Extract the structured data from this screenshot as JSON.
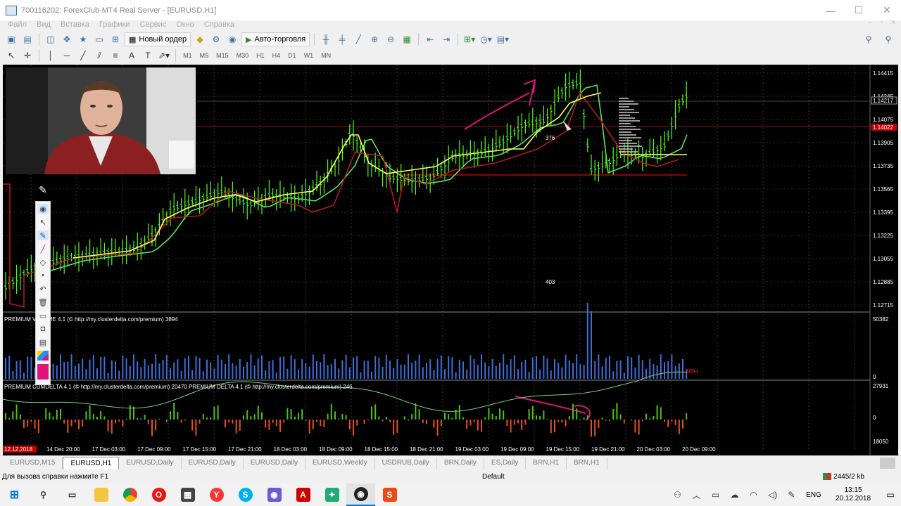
{
  "window": {
    "title": "700116202: ForexClub-MT4 Real Server - [EURUSD,H1]",
    "controls": [
      "—",
      "☐",
      "✕"
    ]
  },
  "menu": [
    "Файл",
    "Вид",
    "Вставка",
    "Графики",
    "Сервис",
    "Окно",
    "Справка"
  ],
  "toolbar": {
    "new_order": "Новый ордер",
    "auto_trading": "Авто-торговля"
  },
  "timeframes": [
    "M1",
    "M5",
    "M15",
    "M30",
    "H1",
    "H4",
    "D1",
    "W1",
    "MN"
  ],
  "chart": {
    "symbol": "EURUSD,H1",
    "price_scale": [
      "1.14415",
      "1.14245",
      "1.14075",
      "1.13905",
      "1.13735",
      "1.13565",
      "1.13395",
      "1.13225",
      "1.13055",
      "1.12885",
      "1.12715"
    ],
    "current_price_label": "1.14217",
    "red_line_price_label": "1.14022",
    "time_axis": [
      "14 Dec 20:00",
      "17 Dec 03:00",
      "17 Dec 09:00",
      "17 Dec 15:00",
      "17 Dec 21:00",
      "18 Dec 03:00",
      "18 Dec 09:00",
      "18 Dec 15:00",
      "18 Dec 21:00",
      "19 Dec 03:00",
      "19 Dec 09:00",
      "19 Dec 15:00",
      "19 Dec 21:00",
      "20 Dec 03:00",
      "20 Dec 09:00"
    ],
    "first_time_label": "12.12.2018",
    "annotation_376": "376",
    "annotation_403": "403"
  },
  "volume_panel": {
    "label": "PREMIUM VOLUME 4.1 (© http://my.clusterdelta.com/premium) 3894",
    "scale_max": "50382",
    "scale_min": "0",
    "last_value": "3894"
  },
  "delta_panel": {
    "label": "PREMIUM CUMDELTA 4.1 (© http://my.clusterdelta.com/premium) 20470  PREMIUM DELTA 4.1 (© http://my.clusterdelta.com/premium) 246",
    "scale_max": "27931",
    "scale_mid": "0",
    "scale_min": "18050"
  },
  "tabs": [
    "EURUSD,M15",
    "EURUSD,H1",
    "EURUSD,Daily",
    "EURUSD,Daily",
    "EURUSD,Daily",
    "EURUSD,Weekly",
    "USDRUB,Daily",
    "BRN,Daily",
    "ES,Daily",
    "BRN,H1",
    "BRN,H1"
  ],
  "active_tab_index": 1,
  "status": {
    "help": "Для вызова справки нажмите F1",
    "profile": "Default",
    "traffic": "2445/2 kb"
  },
  "taskbar": {
    "language": "ENG",
    "time": "13:15",
    "date": "20.12.2018"
  },
  "colors": {
    "price_bars": "#4cff1a",
    "fast_line": "#ffff66",
    "slow_line": "#b31a1a",
    "ma_line": "#5fe05f",
    "magenta": "#e0147a",
    "volume_bars": "#3a6fd8",
    "delta_up": "#4cc21a",
    "delta_down": "#e8501a"
  }
}
